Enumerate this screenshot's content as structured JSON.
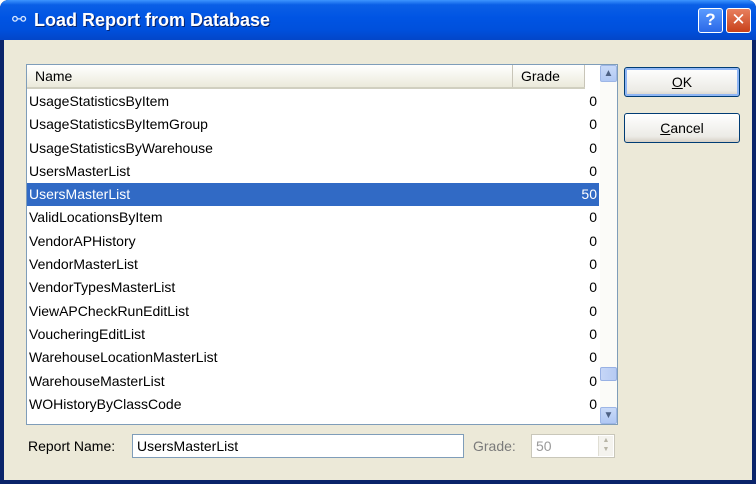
{
  "window": {
    "title": "Load Report from Database",
    "help_label": "?",
    "close_label": "✕",
    "app_icon": "report-link-icon"
  },
  "list": {
    "columns": {
      "name": "Name",
      "grade": "Grade"
    },
    "rows": [
      {
        "name": "UsageStatisticsByItem",
        "grade": "0"
      },
      {
        "name": "UsageStatisticsByItemGroup",
        "grade": "0"
      },
      {
        "name": "UsageStatisticsByWarehouse",
        "grade": "0"
      },
      {
        "name": "UsersMasterList",
        "grade": "0"
      },
      {
        "name": "UsersMasterList",
        "grade": "50",
        "selected": true
      },
      {
        "name": "ValidLocationsByItem",
        "grade": "0"
      },
      {
        "name": "VendorAPHistory",
        "grade": "0"
      },
      {
        "name": "VendorMasterList",
        "grade": "0"
      },
      {
        "name": "VendorTypesMasterList",
        "grade": "0"
      },
      {
        "name": "ViewAPCheckRunEditList",
        "grade": "0"
      },
      {
        "name": "VoucheringEditList",
        "grade": "0"
      },
      {
        "name": "WarehouseLocationMasterList",
        "grade": "0"
      },
      {
        "name": "WarehouseMasterList",
        "grade": "0"
      },
      {
        "name": "WOHistoryByClassCode",
        "grade": "0"
      }
    ],
    "selected_color": "#316ac5"
  },
  "buttons": {
    "ok": {
      "mnemonic": "O",
      "rest": "K"
    },
    "cancel": {
      "mnemonic": "C",
      "rest": "ancel"
    }
  },
  "footer": {
    "report_name_label": "Report Name:",
    "report_name_value": "UsersMasterList",
    "grade_label": "Grade:",
    "grade_value": "50"
  }
}
